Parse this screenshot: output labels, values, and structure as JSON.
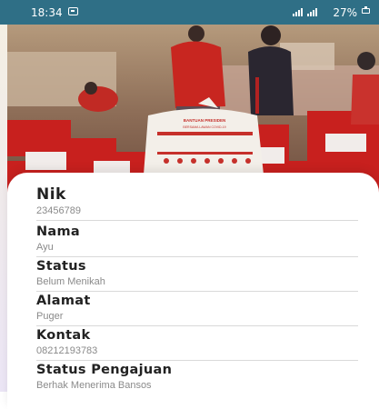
{
  "status_bar": {
    "time": "18:34",
    "notification_icon": "message-icon",
    "signal_icons": [
      "signal-icon",
      "signal-icon"
    ],
    "battery_percent": "27%",
    "battery_icon": "battery-icon",
    "background_color": "#2f6f86"
  },
  "hero_image": {
    "description_icon": "banner-image",
    "bag_label_line1": "BANTUAN PRESIDEN",
    "bag_label_line2": "BERSAMA LAWAN COVID-19"
  },
  "profile": {
    "fields": [
      {
        "label": "Nik",
        "value": "23456789"
      },
      {
        "label": "Nama",
        "value": "Ayu"
      },
      {
        "label": "Status",
        "value": "Belum Menikah"
      },
      {
        "label": "Alamat",
        "value": "Puger"
      },
      {
        "label": "Kontak",
        "value": "08212193783"
      },
      {
        "label": "Status Pengajuan",
        "value": "Berhak Menerima Bansos"
      }
    ]
  }
}
